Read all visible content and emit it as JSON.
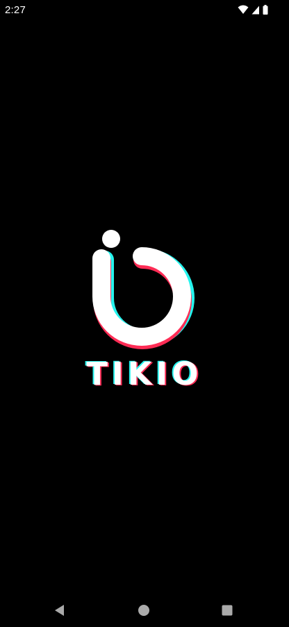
{
  "status_bar": {
    "time": "2:27",
    "icons": [
      "wifi-icon",
      "cellular-signal-icon",
      "battery-icon"
    ]
  },
  "splash": {
    "brand_name": "TIKIO",
    "colors": {
      "background": "#000000",
      "logo": "#FFFFFF",
      "accent_cyan": "#25F4EE",
      "accent_red": "#FE2C55"
    }
  },
  "nav_bar": {
    "buttons": [
      "back-icon",
      "home-icon",
      "recents-icon"
    ]
  }
}
